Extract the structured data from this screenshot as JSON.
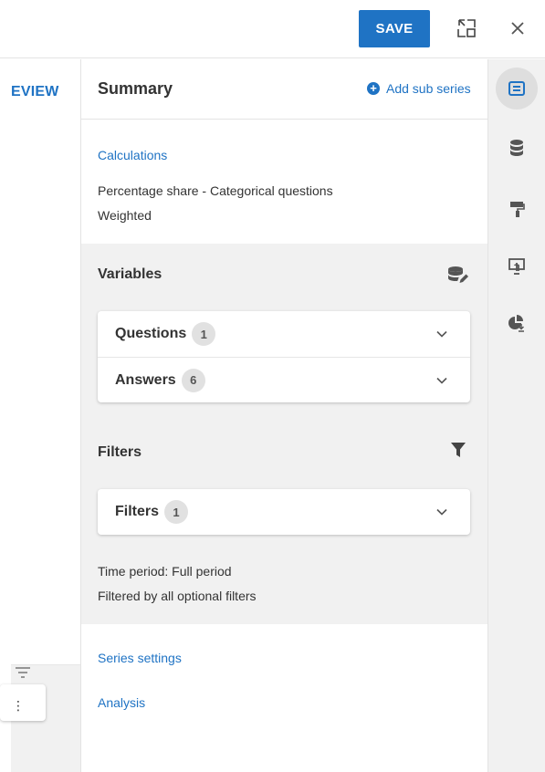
{
  "topbar": {
    "save_label": "SAVE"
  },
  "left_pane": {
    "tab_label": "EVIEW"
  },
  "panel": {
    "title": "Summary",
    "add_sub_series_label": "Add sub series",
    "calculations": {
      "heading": "Calculations",
      "lines": [
        "Percentage share - Categorical questions",
        "Weighted"
      ]
    },
    "variables": {
      "heading": "Variables",
      "rows": [
        {
          "label": "Questions",
          "count": "1"
        },
        {
          "label": "Answers",
          "count": "6"
        }
      ]
    },
    "filters": {
      "heading": "Filters",
      "rows": [
        {
          "label": "Filters",
          "count": "1"
        }
      ],
      "time_period": "Time period: Full period",
      "filtered_by": "Filtered by all optional filters"
    },
    "series_settings_label": "Series settings",
    "analysis_label": "Analysis"
  },
  "rail": {
    "icons": [
      "summary-icon",
      "database-icon",
      "paint-roller-icon",
      "presentation-icon",
      "pie-chart-download-icon"
    ]
  },
  "colors": {
    "accent": "#1f73c4",
    "panel_gray": "#f1f1f1"
  }
}
